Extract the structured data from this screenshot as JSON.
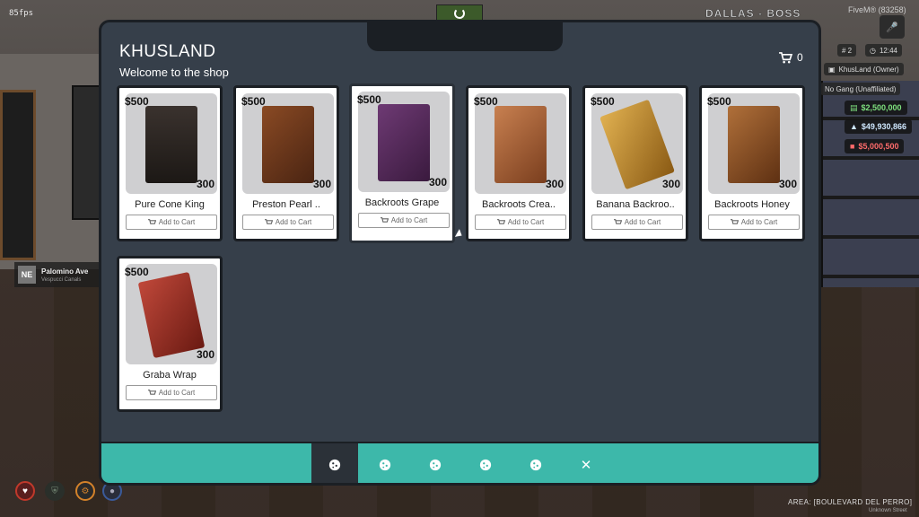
{
  "hud": {
    "fps": "85fps",
    "server_name": "DALLAS - BOSS",
    "player_tag": "FiveM® (83258)",
    "player_id": "# 2",
    "time": "12:44",
    "business": "KhusLand (Owner)",
    "gang": "No Gang (Unaffiliated)",
    "cash": "$2,500,000",
    "bank": "$49,930,866",
    "dirty": "$5,000,500",
    "street_dir": "NE",
    "street_name": "Palomino Ave",
    "street_area": "Vespucci Canals",
    "area": "AREA: [BOULEVARD DEL PERRO]",
    "area_sub": "Unknown Street",
    "colors": {
      "cash": "#7ee07e",
      "bank": "#cfe8ff",
      "dirty": "#ff6b6b"
    }
  },
  "shop": {
    "title": "KHUSLAND",
    "subtitle": "Welcome to the shop",
    "cart_count": "0",
    "cart_icon": "cart-icon",
    "accent": "#3db8aa",
    "button_label": "Add to Cart",
    "products": [
      {
        "name": "Pure Cone King",
        "price": "$500",
        "qty": "300",
        "color": "#2a2522"
      },
      {
        "name": "Preston Pearl ..",
        "price": "$500",
        "qty": "300",
        "color": "#7a3e1e"
      },
      {
        "name": "Backroots Grape",
        "price": "$500",
        "qty": "300",
        "color": "#5a2e5e"
      },
      {
        "name": "Backroots Crea..",
        "price": "$500",
        "qty": "300",
        "color": "#b36a3a"
      },
      {
        "name": "Banana Backroo..",
        "price": "$500",
        "qty": "300",
        "color": "#c8922e"
      },
      {
        "name": "Backroots Honey",
        "price": "$500",
        "qty": "300",
        "color": "#9a5c2a"
      },
      {
        "name": "Graba Wrap",
        "price": "$500",
        "qty": "300",
        "color": "#a53a2a"
      }
    ],
    "tabs": [
      "cookie-icon",
      "cookie-icon",
      "cookie-icon",
      "cookie-icon",
      "cookie-icon",
      "close-icon"
    ]
  }
}
